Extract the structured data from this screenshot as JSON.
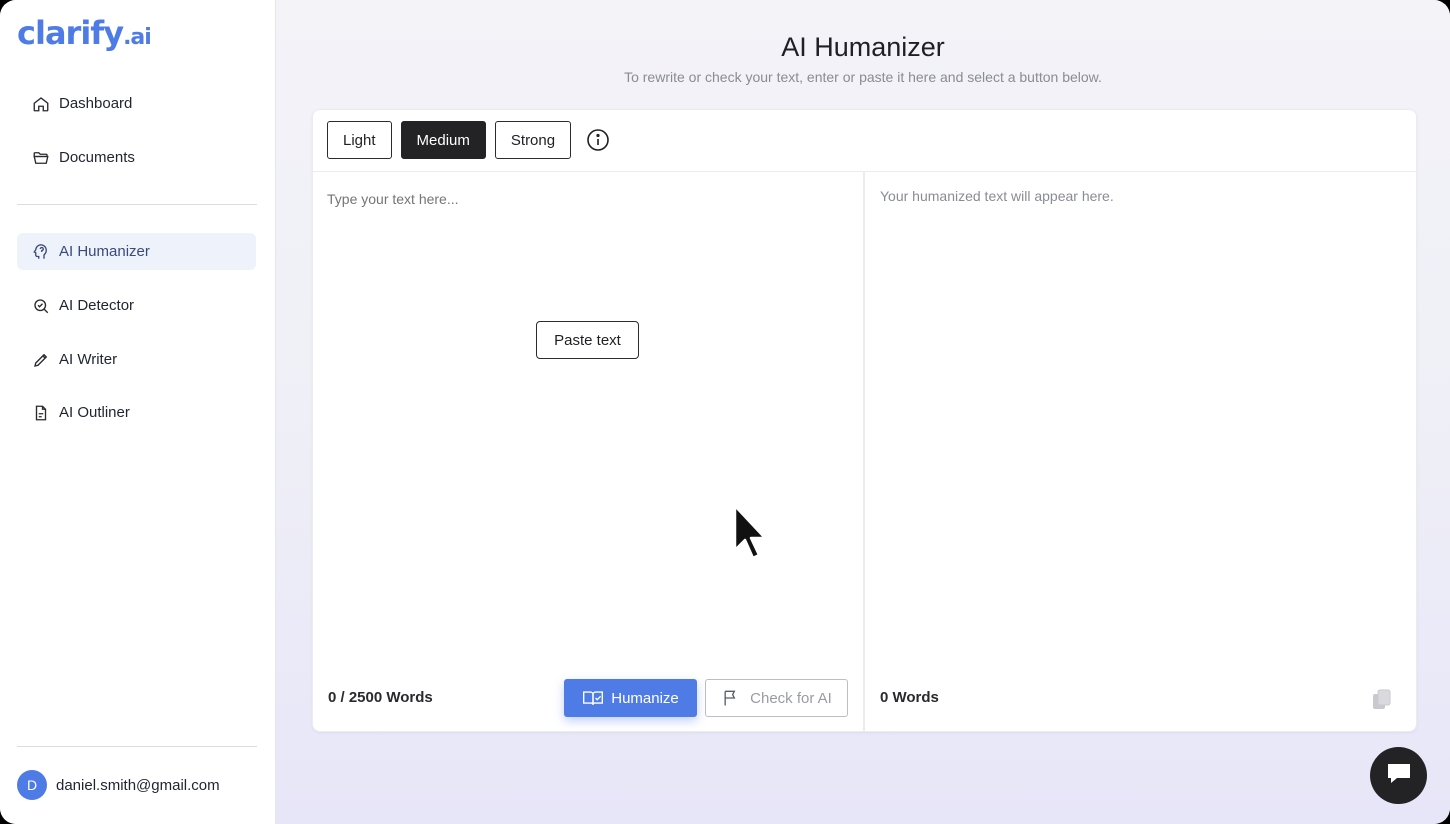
{
  "logo": {
    "main": "clarify",
    "suffix": ".ai"
  },
  "sidebar": {
    "items": [
      {
        "label": "Dashboard",
        "icon": "home-icon"
      },
      {
        "label": "Documents",
        "icon": "folder-icon"
      },
      {
        "label": "AI Humanizer",
        "icon": "brain-icon",
        "active": true
      },
      {
        "label": "AI Detector",
        "icon": "search-check-icon"
      },
      {
        "label": "AI Writer",
        "icon": "pencil-icon"
      },
      {
        "label": "AI Outliner",
        "icon": "document-icon"
      }
    ],
    "user": {
      "initial": "D",
      "email": "daniel.smith@gmail.com"
    }
  },
  "header": {
    "title": "AI Humanizer",
    "subtitle": "To rewrite or check your text, enter or paste it here and select a button below."
  },
  "modes": {
    "options": [
      "Light",
      "Medium",
      "Strong"
    ],
    "selected": "Medium"
  },
  "input": {
    "placeholder": "Type your text here...",
    "paste_label": "Paste text",
    "word_count": "0 / 2500 Words"
  },
  "actions": {
    "humanize_label": "Humanize",
    "check_label": "Check for AI"
  },
  "output": {
    "placeholder": "Your humanized text will appear here.",
    "word_count": "0 Words"
  },
  "colors": {
    "accent": "#4f7be6",
    "dark": "#232326"
  }
}
